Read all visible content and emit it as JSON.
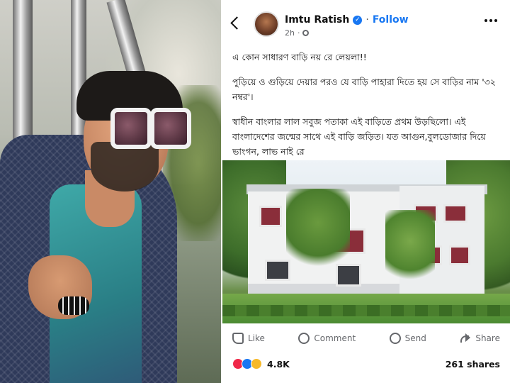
{
  "post": {
    "author": "Imtu Ratish",
    "follow_label": "Follow",
    "separator": "·",
    "time": "2h",
    "text": [
      "এ কোন সাধারণ বাড়ি নয় রে লেয়লা!!",
      "পুড়িয়ে ও গুড়িয়ে দেয়ার পরও যে বাড়ি পাহারা দিতে হয় সে বাড়ির নাম '৩২ নম্বর'।",
      "স্বাধীন বাংলার লাল সবুজ পতাকা এই বাড়িতে প্রথম উড়ছিলো। এই বাংলাদেশের জন্মের সাথে এই বাড়ি জড়িত। যত আগুন,বুলডোজার দিয়ে ভাংগন, লাভ নাই রে"
    ],
    "actions": {
      "like": "Like",
      "comment": "Comment",
      "send": "Send",
      "share": "Share"
    },
    "reaction_count": "4.8K",
    "shares": "261 shares"
  },
  "colors": {
    "brand_blue": "#1877f2",
    "muted_text": "#65676b"
  }
}
